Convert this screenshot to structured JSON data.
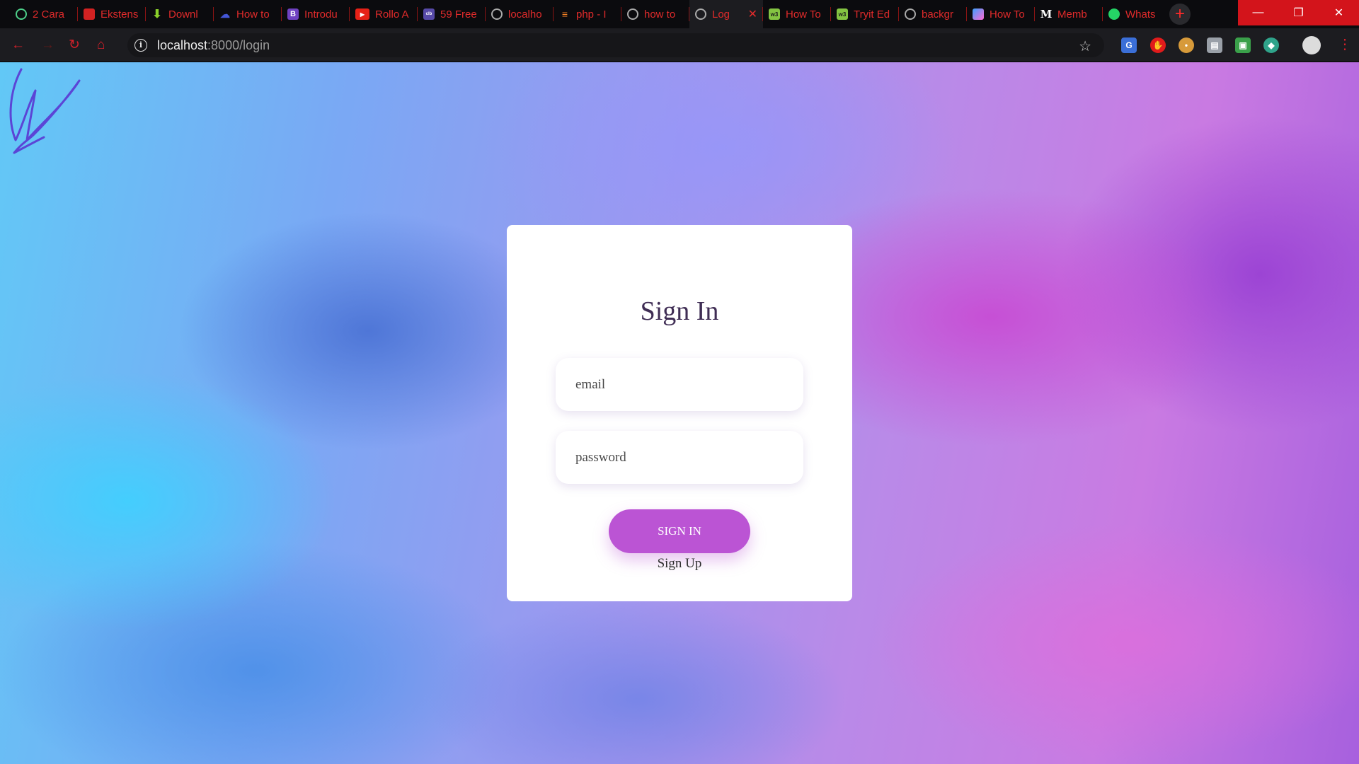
{
  "browser": {
    "tabs": [
      {
        "label": "2 Cara",
        "icon": "ring-icon"
      },
      {
        "label": "Ekstens",
        "icon": "puzzle-icon"
      },
      {
        "label": "Downl",
        "icon": "download-icon"
      },
      {
        "label": "How to",
        "icon": "cloud-icon"
      },
      {
        "label": "Introdu",
        "icon": "bootstrap-icon"
      },
      {
        "label": "Rollo A",
        "icon": "youtube-icon"
      },
      {
        "label": "59 Free",
        "icon": "colorlib-icon"
      },
      {
        "label": "localho",
        "icon": "globe-icon"
      },
      {
        "label": "php - I",
        "icon": "stackoverflow-icon"
      },
      {
        "label": "how to",
        "icon": "globe-icon"
      },
      {
        "label": "Log",
        "icon": "globe-icon",
        "active": true
      },
      {
        "label": "How To",
        "icon": "w3schools-icon"
      },
      {
        "label": "Tryit Ed",
        "icon": "w3schools-icon"
      },
      {
        "label": "backgr",
        "icon": "globe-icon"
      },
      {
        "label": "How To",
        "icon": "image-icon"
      },
      {
        "label": "Memb",
        "icon": "medium-icon"
      },
      {
        "label": "Whats",
        "icon": "whatsapp-icon"
      }
    ],
    "url_host": "localhost",
    "url_rest": ":8000/login"
  },
  "login": {
    "title": "Sign In",
    "email_placeholder": "email",
    "password_placeholder": "password",
    "submit_label": "SIGN IN",
    "signup_label": "Sign Up"
  },
  "colors": {
    "accent": "#bb54d4",
    "browser_accent": "#d4202a",
    "title_text": "#3f2d54"
  }
}
